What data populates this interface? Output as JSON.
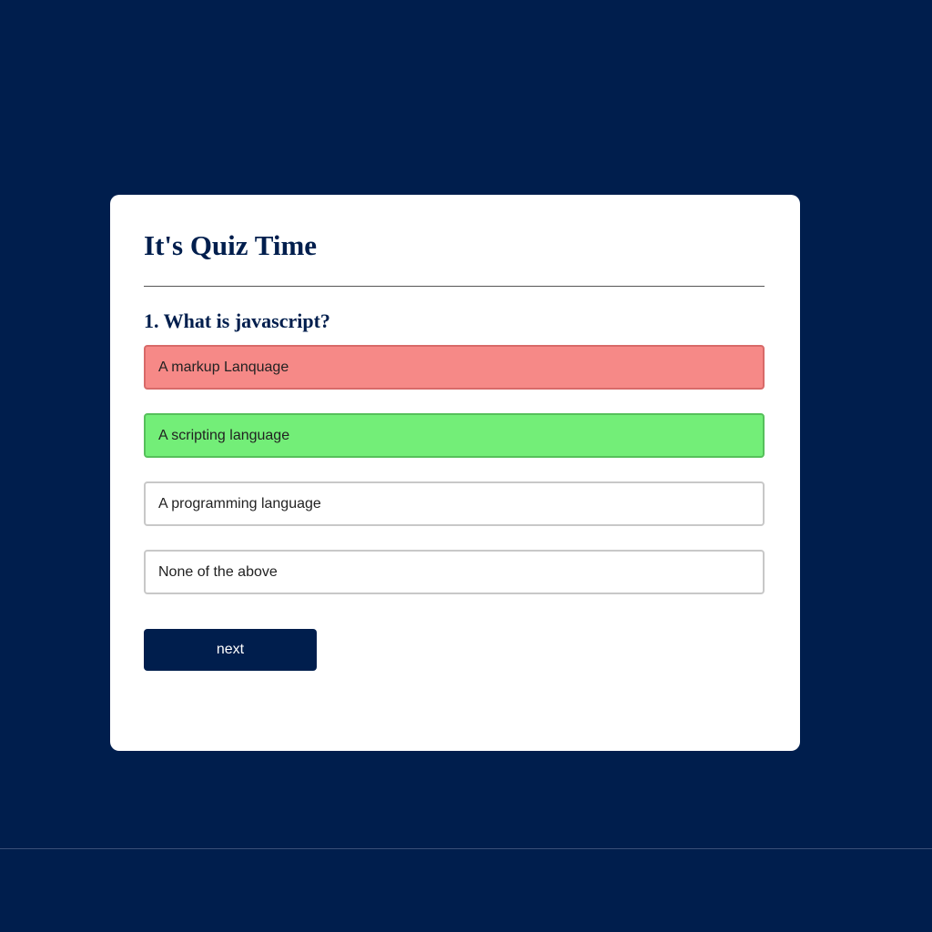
{
  "quiz": {
    "title": "It's Quiz Time",
    "question": "1. What is javascript?",
    "answers": [
      {
        "label": "A markup Lanquage",
        "state": "incorrect"
      },
      {
        "label": "A scripting language",
        "state": "correct"
      },
      {
        "label": "A programming language",
        "state": "default"
      },
      {
        "label": "None of the above",
        "state": "default"
      }
    ],
    "next_label": "next"
  },
  "colors": {
    "background": "#001e4d",
    "card": "#ffffff",
    "incorrect": "#f68987",
    "correct": "#73ee78",
    "button": "#001e4d"
  }
}
